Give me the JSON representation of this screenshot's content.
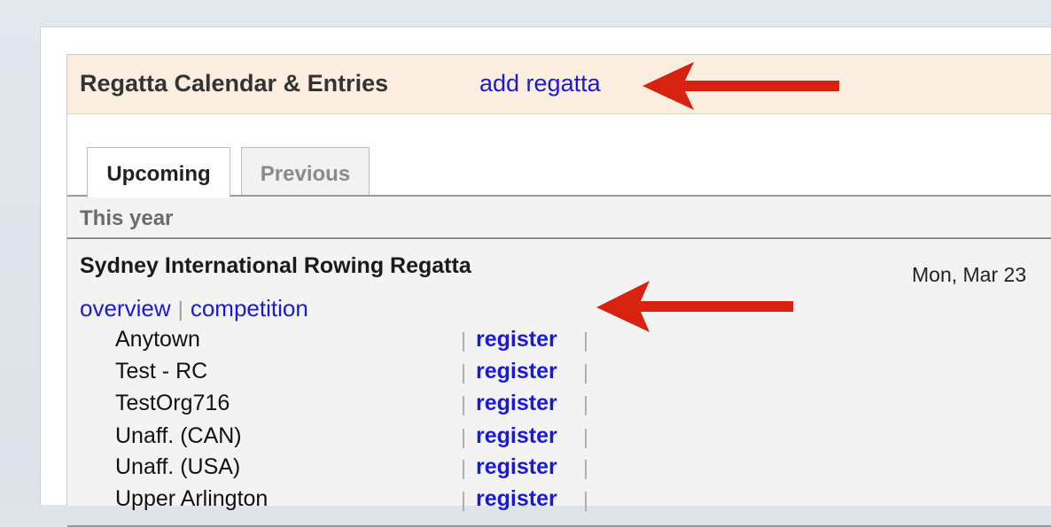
{
  "panel": {
    "title": "Regatta Calendar & Entries",
    "add_link": "add regatta"
  },
  "tabs": [
    {
      "label": "Upcoming",
      "active": true
    },
    {
      "label": "Previous",
      "active": false
    }
  ],
  "section": {
    "heading": "This year"
  },
  "regatta": {
    "name": "Sydney International Rowing Regatta",
    "date": "Mon, Mar 23",
    "links": {
      "overview": "overview",
      "separator": "|",
      "competition": "competition"
    },
    "organizations": [
      {
        "name": "Anytown",
        "action": "register"
      },
      {
        "name": "Test - RC",
        "action": "register"
      },
      {
        "name": "TestOrg716",
        "action": "register"
      },
      {
        "name": "Unaff. (CAN)",
        "action": "register"
      },
      {
        "name": "Unaff. (USA)",
        "action": "register"
      },
      {
        "name": "Upper Arlington",
        "action": "register"
      }
    ],
    "pipe": "|"
  },
  "annotations": {
    "arrow_color": "#d6220f",
    "arrows": [
      "red-arrow-icon",
      "red-arrow-icon"
    ]
  },
  "colors": {
    "link": "#1a1ad6",
    "header_bg": "#fbeee0"
  }
}
